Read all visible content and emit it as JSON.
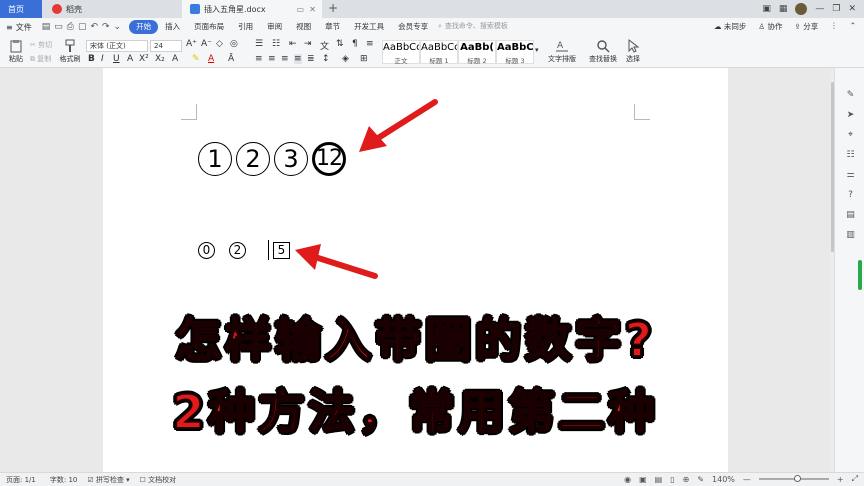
{
  "tabs": {
    "home": "首页",
    "daoke": "稻壳",
    "document": "插入五角星.docx"
  },
  "window_right": {
    "sync": "未同步",
    "collab": "协作",
    "share": "分享"
  },
  "menu": {
    "file": "文件",
    "items": [
      "开始",
      "插入",
      "页面布局",
      "引用",
      "审阅",
      "视图",
      "章节",
      "开发工具",
      "会员专享"
    ],
    "active": "开始",
    "search_placeholder": "查找命令、搜索模板"
  },
  "ribbon": {
    "paste": "粘贴",
    "cut": "剪切",
    "copy": "复制",
    "format_painter": "格式刷",
    "font_name": "宋体 (正文)",
    "font_size": "24",
    "styles": [
      {
        "preview": "AaBbCcDd",
        "name": "正文"
      },
      {
        "preview": "AaBbCcI",
        "name": "标题 1"
      },
      {
        "preview": "AaBb(",
        "name": "标题 2"
      },
      {
        "preview": "AaBbCc",
        "name": "标题 3"
      }
    ],
    "text_layout": "文字排版",
    "find_replace": "查找替换",
    "select": "选择"
  },
  "document": {
    "row1": [
      "1",
      "2",
      "3",
      "12"
    ],
    "row2": [
      "0",
      "2"
    ],
    "boxed": "5",
    "headline1": "怎样输入带圈的数字?",
    "headline2": "2种方法，常用第二种"
  },
  "status": {
    "page": "页面: 1/1",
    "words": "字数: 10",
    "spell": "拼写检查",
    "proof": "文档校对",
    "zoom": "140%",
    "zoom_fraction": 0.55
  },
  "colors": {
    "accent": "#3a6fd8",
    "headline_red": "#e01b1b",
    "arrow_red": "#e01b1b"
  }
}
